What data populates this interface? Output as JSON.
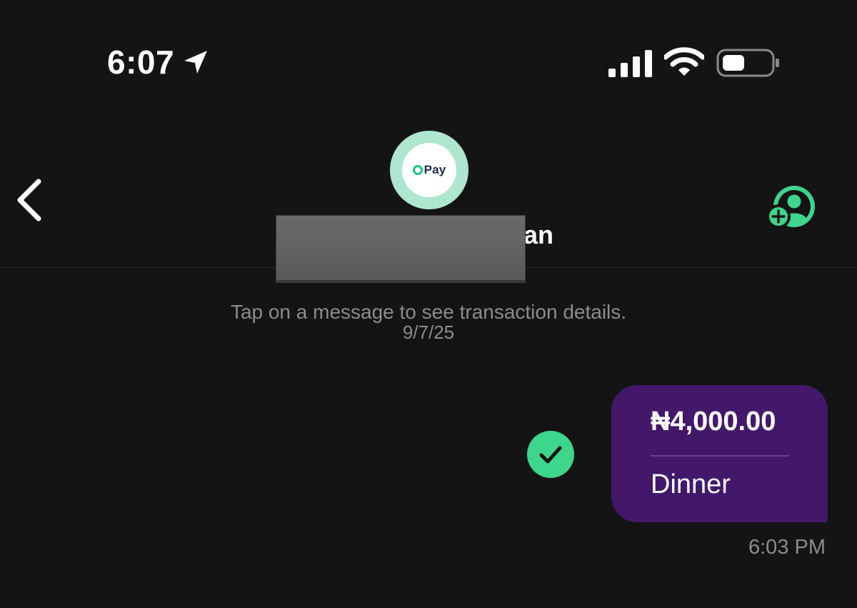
{
  "status_bar": {
    "time": "6:07",
    "icons": [
      "location-arrow-icon",
      "cellular-signal-icon",
      "wifi-icon",
      "battery-icon"
    ]
  },
  "header": {
    "back_icon": "chevron-left-icon",
    "avatar_logo_text": "Pay",
    "contact_name_visible": "an",
    "add_contact_icon": "add-contact-icon"
  },
  "conversation": {
    "hint": "Tap on a message to see transaction details.",
    "date": "9/7/25",
    "messages": [
      {
        "amount": "₦4,000.00",
        "note": "Dinner",
        "time": "6:03 PM",
        "status_icon": "check-circle-icon"
      }
    ]
  },
  "colors": {
    "background": "#141414",
    "accent_green": "#3dd68c",
    "bubble_purple": "#43186b",
    "secondary_text": "#8c8c8c",
    "avatar_ring": "#aee6cf"
  }
}
